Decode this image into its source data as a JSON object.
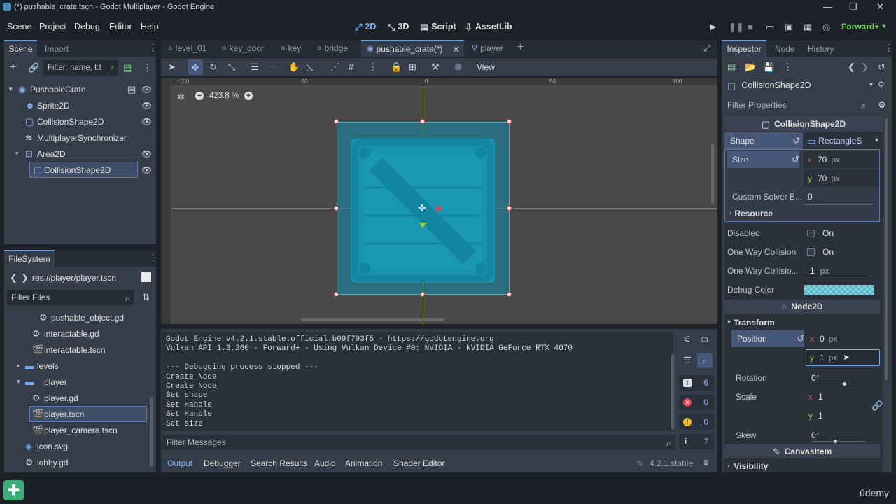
{
  "window": {
    "title": "(*) pushable_crate.tscn - Godot Multiplayer - Godot Engine"
  },
  "menu": {
    "items": [
      "Scene",
      "Project",
      "Debug",
      "Editor",
      "Help"
    ]
  },
  "workspaces": {
    "d2": "2D",
    "d3": "3D",
    "script": "Script",
    "assetlib": "AssetLib"
  },
  "renderer": "Forward+",
  "scene_dock": {
    "tab_scene": "Scene",
    "tab_import": "Import",
    "filter_placeholder": "Filter: name, t:t",
    "nodes": [
      {
        "label": "PushableCrate"
      },
      {
        "label": "Sprite2D"
      },
      {
        "label": "CollisionShape2D"
      },
      {
        "label": "MultiplayerSynchronizer"
      },
      {
        "label": "Area2D"
      },
      {
        "label": "CollisionShape2D"
      }
    ]
  },
  "filesystem": {
    "title": "FileSystem",
    "path": "res://player/player.tscn",
    "filter_placeholder": "Filter Files",
    "items": [
      {
        "label": "pushable_object.gd"
      },
      {
        "label": "interactable.gd"
      },
      {
        "label": "interactable.tscn"
      },
      {
        "label": "levels"
      },
      {
        "label": "player"
      },
      {
        "label": "player.gd"
      },
      {
        "label": "player.tscn"
      },
      {
        "label": "player_camera.tscn"
      },
      {
        "label": "icon.svg"
      },
      {
        "label": "lobby.gd"
      }
    ]
  },
  "editor_tabs": [
    {
      "label": "level_01"
    },
    {
      "label": "key_door"
    },
    {
      "label": "key"
    },
    {
      "label": "bridge"
    },
    {
      "label": "pushable_crate(*)"
    },
    {
      "label": "player"
    }
  ],
  "viewport": {
    "view_label": "View",
    "zoom": "423.8 %",
    "ruler_labels": [
      "-100",
      "-50",
      "0",
      "50",
      "100"
    ]
  },
  "output": {
    "lines": [
      "Godot Engine v4.2.1.stable.official.b09f793f5 - https://godotengine.org",
      "Vulkan API 1.3.260 - Forward+ - Using Vulkan Device #0: NVIDIA - NVIDIA GeForce RTX 4070",
      "",
      "--- Debugging process stopped ---",
      "Create Node",
      "Create Node",
      "Set shape",
      "Set Handle",
      "Set Handle",
      "Set size"
    ],
    "filter_placeholder": "Filter Messages",
    "counts": {
      "log": "6",
      "errors": "0",
      "warnings": "0",
      "info": "7"
    },
    "bottom_tabs": [
      "Output",
      "Debugger",
      "Search Results",
      "Audio",
      "Animation",
      "Shader Editor"
    ],
    "version": "4.2.1.stable"
  },
  "inspector": {
    "tabs": {
      "inspector": "Inspector",
      "node": "Node",
      "history": "History"
    },
    "object": "CollisionShape2D",
    "filter_placeholder": "Filter Properties",
    "section_title": "CollisionShape2D",
    "shape_label": "Shape",
    "shape_value": "RectangleS",
    "size_label": "Size",
    "size_x": "70",
    "size_y": "70",
    "unit": "px",
    "solver_label": "Custom Solver B...",
    "solver_value": "0",
    "resource_label": "Resource",
    "disabled_label": "Disabled",
    "on_label": "On",
    "oneway_label": "One Way Collision",
    "oneway_margin_label": "One Way Collisio...",
    "oneway_margin_value": "1",
    "debug_color_label": "Debug Color",
    "node2d_title": "Node2D",
    "transform_label": "Transform",
    "position_label": "Position",
    "pos_x": "0",
    "pos_y": "1",
    "rotation_label": "Rotation",
    "rotation_value": "0",
    "scale_label": "Scale",
    "scale_x": "1",
    "scale_y": "1",
    "skew_label": "Skew",
    "skew_value": "0",
    "canvasitem_title": "CanvasItem",
    "visibility_label": "Visibility",
    "degree": "°"
  },
  "watermark": "ūdemy"
}
